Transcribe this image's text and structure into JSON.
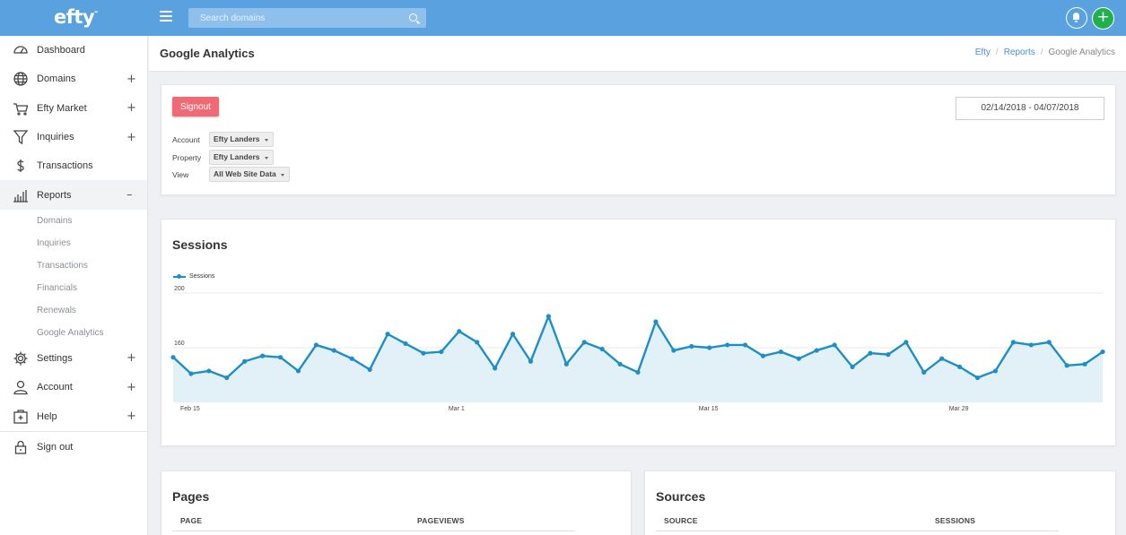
{
  "topbar": {
    "logo": "efty",
    "search_placeholder": "Search domains",
    "icons": {
      "menu": "hamburger-icon",
      "search": "search-icon",
      "notifications": "bell-icon",
      "add": "plus-icon"
    },
    "add_symbol": "+"
  },
  "sidebar": {
    "items": [
      {
        "label": "Dashboard",
        "icon": "dashboard-icon",
        "expand": ""
      },
      {
        "label": "Domains",
        "icon": "globe-icon",
        "expand": "+"
      },
      {
        "label": "Efty Market",
        "icon": "cart-icon",
        "expand": "+"
      },
      {
        "label": "Inquiries",
        "icon": "funnel-icon",
        "expand": "+"
      },
      {
        "label": "Transactions",
        "icon": "dollar-icon",
        "expand": ""
      },
      {
        "label": "Reports",
        "icon": "bar-chart-icon",
        "expand": "–"
      }
    ],
    "report_subitems": [
      "Domains",
      "Inquiries",
      "Transactions",
      "Financials",
      "Renewals",
      "Google Analytics"
    ],
    "bottom_items": [
      {
        "label": "Settings",
        "icon": "gear-icon",
        "expand": "+"
      },
      {
        "label": "Account",
        "icon": "user-icon",
        "expand": "+"
      },
      {
        "label": "Help",
        "icon": "help-icon",
        "expand": "+"
      }
    ],
    "signout": {
      "label": "Sign out",
      "icon": "lock-icon"
    }
  },
  "header": {
    "title": "Google Analytics",
    "breadcrumb": [
      "Efty",
      "Reports",
      "Google Analytics"
    ]
  },
  "controls": {
    "signout_label": "Signout",
    "date_range": "02/14/2018 - 04/07/2018",
    "filters": [
      {
        "label": "Account",
        "value": "Efty Landers"
      },
      {
        "label": "Property",
        "value": "Efty Landers"
      },
      {
        "label": "View",
        "value": "All Web Site Data"
      }
    ]
  },
  "sessions_card": {
    "title": "Sessions"
  },
  "chart_data": {
    "type": "area",
    "title": "Sessions",
    "legend": [
      "Sessions"
    ],
    "legend_position": "top-left",
    "ylim": [
      120,
      200
    ],
    "y_ticks": [
      200,
      160
    ],
    "x_tick_labels": [
      "Feb 15",
      "Mar 1",
      "Mar 15",
      "Mar 29"
    ],
    "x_tick_index": [
      0,
      15,
      29,
      43
    ],
    "grid": true,
    "series": [
      {
        "name": "Sessions",
        "color": "#1e8fc6",
        "fill": "#e2f1f8",
        "values": [
          153,
          141,
          143,
          138,
          150,
          154,
          153,
          143,
          162,
          158,
          152,
          144,
          170,
          163,
          156,
          157,
          172,
          164,
          145,
          170,
          150,
          183,
          148,
          164,
          159,
          148,
          142,
          179,
          158,
          161,
          160,
          162,
          162,
          154,
          157,
          152,
          158,
          162,
          146,
          156,
          155,
          164,
          142,
          152,
          146,
          138,
          143,
          164,
          162,
          164,
          147,
          148,
          157
        ]
      }
    ]
  },
  "pages_card": {
    "title": "Pages",
    "col1": "PAGE",
    "col2": "PAGEVIEWS"
  },
  "sources_card": {
    "title": "Sources",
    "col1": "SOURCE",
    "col2": "SESSIONS"
  }
}
